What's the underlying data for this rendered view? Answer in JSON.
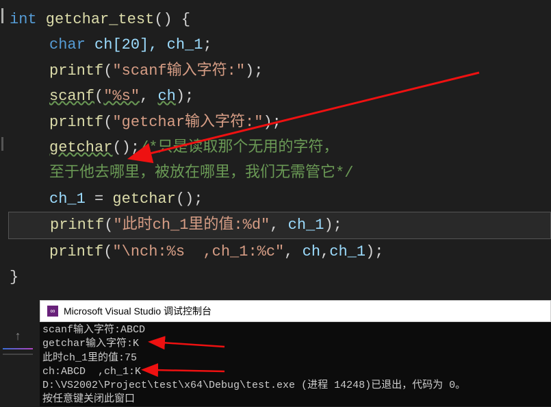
{
  "code": {
    "l1_int": "int",
    "l1_fn": " getchar_test",
    "l1_rest": "() {",
    "l2_type": "char",
    "l2_vars": " ch[20], ch_1",
    "l2_end": ";",
    "l3_fn": "printf",
    "l3_open": "(",
    "l3_str": "\"scanf输入字符:\"",
    "l3_close": ");",
    "l4_fn": "scanf",
    "l4_open": "(",
    "l4_str": "\"%s\"",
    "l4_mid": ", ",
    "l4_arg": "ch",
    "l4_close": ");",
    "l5_fn": "printf",
    "l5_open": "(",
    "l5_str": "\"getchar输入字符:\"",
    "l5_close": ");",
    "l6_fn": "getchar",
    "l6_open": "();",
    "l6_comment1": "/*只是读取那个无用的字符，",
    "l6_comment2": "至于他去哪里，被放在哪里，我们无需管它*/",
    "l7_var": "ch_1",
    "l7_op": " = ",
    "l7_fn": "getchar",
    "l7_rest": "();",
    "l8_fn": "printf",
    "l8_open": "(",
    "l8_str": "\"此时ch_1里的值:%d\"",
    "l8_mid": ", ",
    "l8_arg": "ch_1",
    "l8_close": ");",
    "l9_fn": "printf",
    "l9_open": "(",
    "l9_str": "\"\\nch:%s  ,ch_1:%c\"",
    "l9_mid": ", ",
    "l9_arg1": "ch",
    "l9_comma": ",",
    "l9_arg2": "ch_1",
    "l9_close": ");",
    "l10": "}"
  },
  "console": {
    "title": "Microsoft Visual Studio 调试控制台",
    "lines": [
      "scanf输入字符:ABCD",
      "getchar输入字符:K",
      "此时ch_1里的值:75",
      "ch:ABCD  ,ch_1:K",
      "D:\\VS2002\\Project\\test\\x64\\Debug\\test.exe (进程 14248)已退出，代码为 0。",
      "按任意键关闭此窗口"
    ]
  },
  "icons": {
    "vs": "∞"
  }
}
